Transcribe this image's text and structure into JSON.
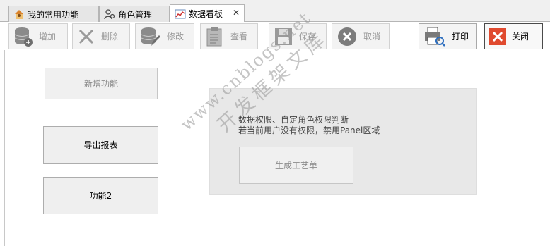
{
  "tabs": [
    {
      "label": "我的常用功能",
      "icon": "home-user-icon"
    },
    {
      "label": "角色管理",
      "icon": "users-icon"
    },
    {
      "label": "数据看板",
      "icon": "line-chart-icon",
      "active": true
    }
  ],
  "tab_close_glyph": "✕",
  "toolbar": {
    "add_label": "增加",
    "delete_label": "删除",
    "edit_label": "修改",
    "view_label": "查看",
    "save_label": "保存",
    "cancel_label": "取消",
    "print_label": "打印",
    "close_label": "关闭"
  },
  "content": {
    "new_function_label": "新增功能",
    "export_report_label": "导出报表",
    "function2_label": "功能2"
  },
  "panel": {
    "line1": "数据权限、自定角色权限判断",
    "line2": "若当前用户没有权限，禁用Panel区域",
    "generate_label": "生成工艺单"
  },
  "watermark": {
    "line1": "www.cnblogs.net",
    "line2": "开发框架文库"
  },
  "colors": {
    "close_accent": "#e04a2f",
    "disabled_text": "#9a9a9a",
    "panel_bg": "#e8e8e8"
  }
}
